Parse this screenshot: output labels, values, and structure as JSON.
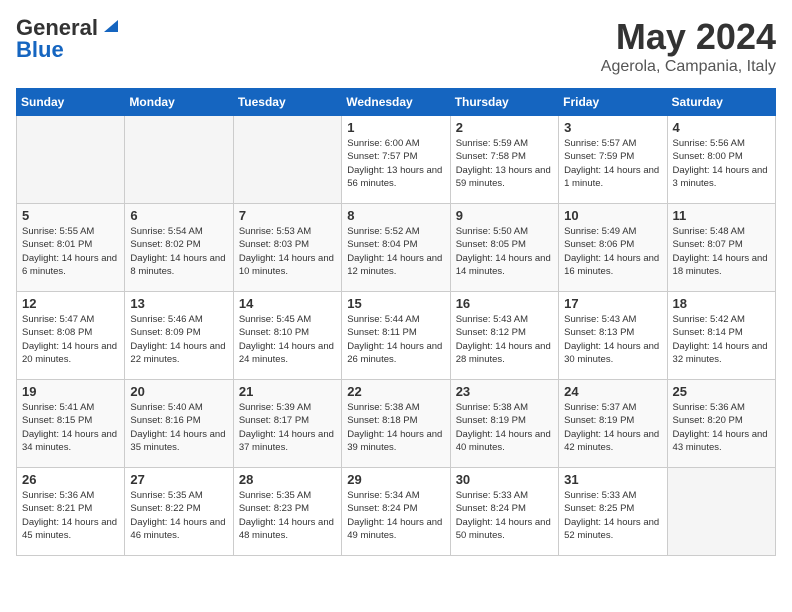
{
  "logo": {
    "general": "General",
    "blue": "Blue"
  },
  "title": "May 2024",
  "location": "Agerola, Campania, Italy",
  "days_of_week": [
    "Sunday",
    "Monday",
    "Tuesday",
    "Wednesday",
    "Thursday",
    "Friday",
    "Saturday"
  ],
  "weeks": [
    [
      {
        "day": "",
        "empty": true
      },
      {
        "day": "",
        "empty": true
      },
      {
        "day": "",
        "empty": true
      },
      {
        "day": "1",
        "sunrise": "Sunrise: 6:00 AM",
        "sunset": "Sunset: 7:57 PM",
        "daylight": "Daylight: 13 hours and 56 minutes."
      },
      {
        "day": "2",
        "sunrise": "Sunrise: 5:59 AM",
        "sunset": "Sunset: 7:58 PM",
        "daylight": "Daylight: 13 hours and 59 minutes."
      },
      {
        "day": "3",
        "sunrise": "Sunrise: 5:57 AM",
        "sunset": "Sunset: 7:59 PM",
        "daylight": "Daylight: 14 hours and 1 minute."
      },
      {
        "day": "4",
        "sunrise": "Sunrise: 5:56 AM",
        "sunset": "Sunset: 8:00 PM",
        "daylight": "Daylight: 14 hours and 3 minutes."
      }
    ],
    [
      {
        "day": "5",
        "sunrise": "Sunrise: 5:55 AM",
        "sunset": "Sunset: 8:01 PM",
        "daylight": "Daylight: 14 hours and 6 minutes."
      },
      {
        "day": "6",
        "sunrise": "Sunrise: 5:54 AM",
        "sunset": "Sunset: 8:02 PM",
        "daylight": "Daylight: 14 hours and 8 minutes."
      },
      {
        "day": "7",
        "sunrise": "Sunrise: 5:53 AM",
        "sunset": "Sunset: 8:03 PM",
        "daylight": "Daylight: 14 hours and 10 minutes."
      },
      {
        "day": "8",
        "sunrise": "Sunrise: 5:52 AM",
        "sunset": "Sunset: 8:04 PM",
        "daylight": "Daylight: 14 hours and 12 minutes."
      },
      {
        "day": "9",
        "sunrise": "Sunrise: 5:50 AM",
        "sunset": "Sunset: 8:05 PM",
        "daylight": "Daylight: 14 hours and 14 minutes."
      },
      {
        "day": "10",
        "sunrise": "Sunrise: 5:49 AM",
        "sunset": "Sunset: 8:06 PM",
        "daylight": "Daylight: 14 hours and 16 minutes."
      },
      {
        "day": "11",
        "sunrise": "Sunrise: 5:48 AM",
        "sunset": "Sunset: 8:07 PM",
        "daylight": "Daylight: 14 hours and 18 minutes."
      }
    ],
    [
      {
        "day": "12",
        "sunrise": "Sunrise: 5:47 AM",
        "sunset": "Sunset: 8:08 PM",
        "daylight": "Daylight: 14 hours and 20 minutes."
      },
      {
        "day": "13",
        "sunrise": "Sunrise: 5:46 AM",
        "sunset": "Sunset: 8:09 PM",
        "daylight": "Daylight: 14 hours and 22 minutes."
      },
      {
        "day": "14",
        "sunrise": "Sunrise: 5:45 AM",
        "sunset": "Sunset: 8:10 PM",
        "daylight": "Daylight: 14 hours and 24 minutes."
      },
      {
        "day": "15",
        "sunrise": "Sunrise: 5:44 AM",
        "sunset": "Sunset: 8:11 PM",
        "daylight": "Daylight: 14 hours and 26 minutes."
      },
      {
        "day": "16",
        "sunrise": "Sunrise: 5:43 AM",
        "sunset": "Sunset: 8:12 PM",
        "daylight": "Daylight: 14 hours and 28 minutes."
      },
      {
        "day": "17",
        "sunrise": "Sunrise: 5:43 AM",
        "sunset": "Sunset: 8:13 PM",
        "daylight": "Daylight: 14 hours and 30 minutes."
      },
      {
        "day": "18",
        "sunrise": "Sunrise: 5:42 AM",
        "sunset": "Sunset: 8:14 PM",
        "daylight": "Daylight: 14 hours and 32 minutes."
      }
    ],
    [
      {
        "day": "19",
        "sunrise": "Sunrise: 5:41 AM",
        "sunset": "Sunset: 8:15 PM",
        "daylight": "Daylight: 14 hours and 34 minutes."
      },
      {
        "day": "20",
        "sunrise": "Sunrise: 5:40 AM",
        "sunset": "Sunset: 8:16 PM",
        "daylight": "Daylight: 14 hours and 35 minutes."
      },
      {
        "day": "21",
        "sunrise": "Sunrise: 5:39 AM",
        "sunset": "Sunset: 8:17 PM",
        "daylight": "Daylight: 14 hours and 37 minutes."
      },
      {
        "day": "22",
        "sunrise": "Sunrise: 5:38 AM",
        "sunset": "Sunset: 8:18 PM",
        "daylight": "Daylight: 14 hours and 39 minutes."
      },
      {
        "day": "23",
        "sunrise": "Sunrise: 5:38 AM",
        "sunset": "Sunset: 8:19 PM",
        "daylight": "Daylight: 14 hours and 40 minutes."
      },
      {
        "day": "24",
        "sunrise": "Sunrise: 5:37 AM",
        "sunset": "Sunset: 8:19 PM",
        "daylight": "Daylight: 14 hours and 42 minutes."
      },
      {
        "day": "25",
        "sunrise": "Sunrise: 5:36 AM",
        "sunset": "Sunset: 8:20 PM",
        "daylight": "Daylight: 14 hours and 43 minutes."
      }
    ],
    [
      {
        "day": "26",
        "sunrise": "Sunrise: 5:36 AM",
        "sunset": "Sunset: 8:21 PM",
        "daylight": "Daylight: 14 hours and 45 minutes."
      },
      {
        "day": "27",
        "sunrise": "Sunrise: 5:35 AM",
        "sunset": "Sunset: 8:22 PM",
        "daylight": "Daylight: 14 hours and 46 minutes."
      },
      {
        "day": "28",
        "sunrise": "Sunrise: 5:35 AM",
        "sunset": "Sunset: 8:23 PM",
        "daylight": "Daylight: 14 hours and 48 minutes."
      },
      {
        "day": "29",
        "sunrise": "Sunrise: 5:34 AM",
        "sunset": "Sunset: 8:24 PM",
        "daylight": "Daylight: 14 hours and 49 minutes."
      },
      {
        "day": "30",
        "sunrise": "Sunrise: 5:33 AM",
        "sunset": "Sunset: 8:24 PM",
        "daylight": "Daylight: 14 hours and 50 minutes."
      },
      {
        "day": "31",
        "sunrise": "Sunrise: 5:33 AM",
        "sunset": "Sunset: 8:25 PM",
        "daylight": "Daylight: 14 hours and 52 minutes."
      },
      {
        "day": "",
        "empty": true
      }
    ]
  ]
}
